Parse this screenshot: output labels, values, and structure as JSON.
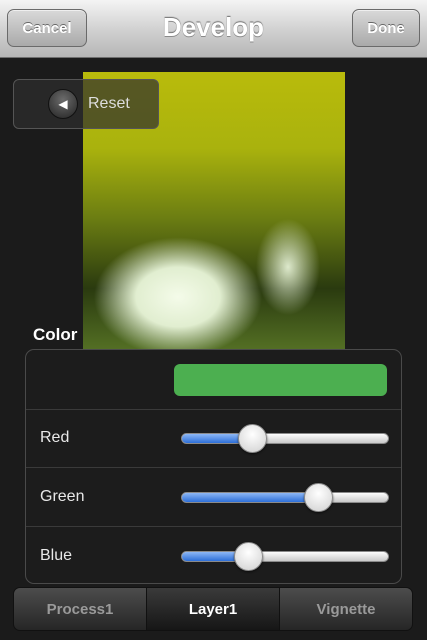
{
  "navbar": {
    "title": "Develop",
    "cancel_label": "Cancel",
    "done_label": "Done"
  },
  "reset": {
    "label": "Reset",
    "icon": "left-arrow-icon"
  },
  "color_section": {
    "label": "Color",
    "swatch_color": "#4caf50",
    "sliders": [
      {
        "label": "Red",
        "value": 0.34
      },
      {
        "label": "Green",
        "value": 0.66
      },
      {
        "label": "Blue",
        "value": 0.32
      }
    ]
  },
  "tabs": [
    {
      "label": "Process1",
      "active": false
    },
    {
      "label": "Layer1",
      "active": true
    },
    {
      "label": "Vignette",
      "active": false
    }
  ],
  "colors": {
    "accent_blue": "#2d6fd8",
    "tint": "#b9bb0c"
  }
}
